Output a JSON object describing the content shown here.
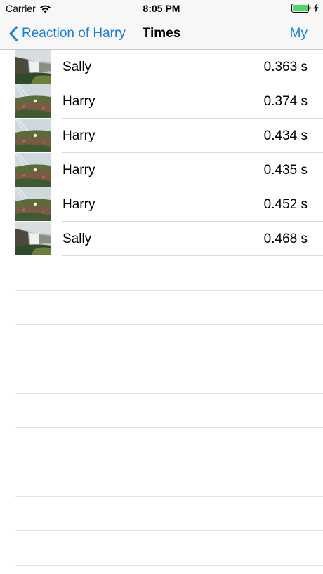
{
  "status_bar": {
    "carrier": "Carrier",
    "time": "8:05 PM",
    "icons": [
      "wifi-icon",
      "battery-icon",
      "bolt-icon"
    ],
    "battery_color": "#4cd964"
  },
  "nav": {
    "back_label": "Reaction of Harry",
    "title": "Times",
    "right_label": "My",
    "accent_color": "#1a7fdb"
  },
  "rows": [
    {
      "name": "Sally",
      "time": "0.363 s",
      "thumbnail": "waterfall"
    },
    {
      "name": "Harry",
      "time": "0.374 s",
      "thumbnail": "meadow"
    },
    {
      "name": "Harry",
      "time": "0.434 s",
      "thumbnail": "meadow"
    },
    {
      "name": "Harry",
      "time": "0.435 s",
      "thumbnail": "meadow"
    },
    {
      "name": "Harry",
      "time": "0.452 s",
      "thumbnail": "meadow"
    },
    {
      "name": "Sally",
      "time": "0.468 s",
      "thumbnail": "waterfall"
    }
  ]
}
